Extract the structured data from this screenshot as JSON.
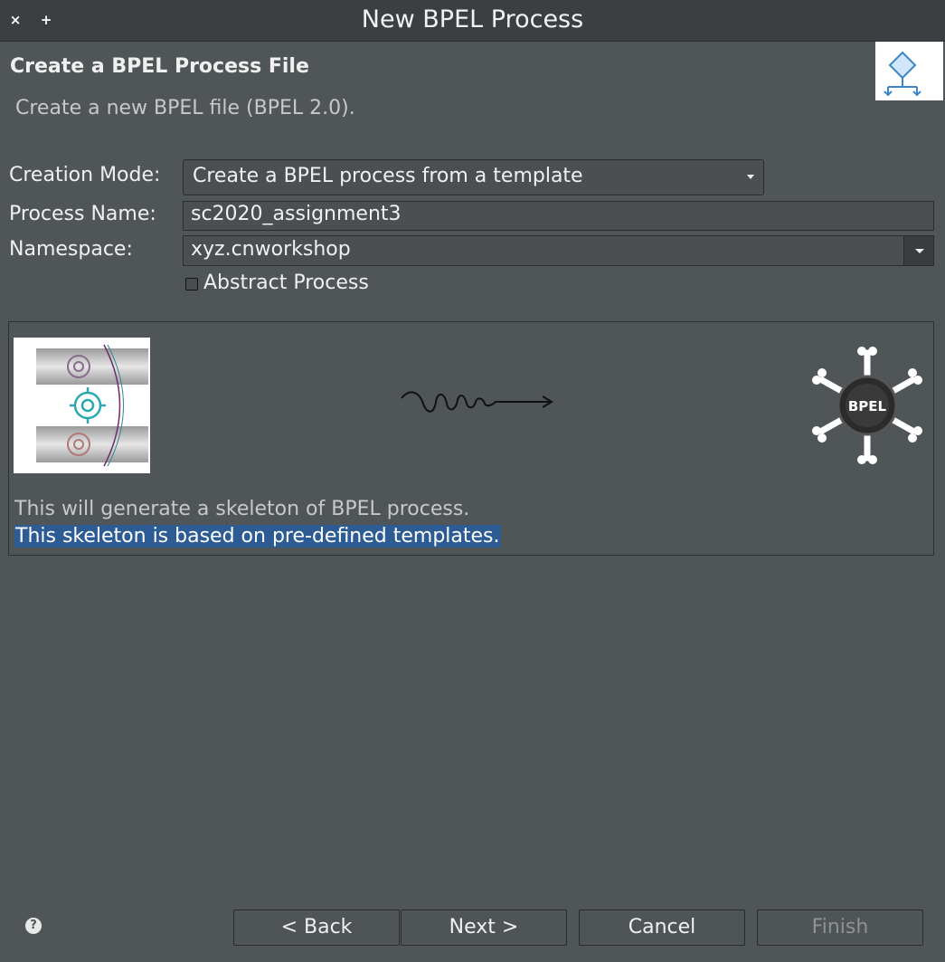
{
  "window": {
    "title": "New BPEL Process",
    "close_glyph": "×",
    "maximize_glyph": "+"
  },
  "header": {
    "title": "Create a BPEL Process File",
    "description": "Create a new BPEL file (BPEL 2.0).",
    "icon": "bpel-wizard-icon"
  },
  "form": {
    "creation_mode_label": "Creation Mode:",
    "creation_mode_value": "Create a BPEL process from a template",
    "process_name_label": "Process Name:",
    "process_name_value": "sc2020_assignment3",
    "namespace_label": "Namespace:",
    "namespace_value": "xyz.cnworkshop",
    "abstract_label": "Abstract Process",
    "abstract_checked": false
  },
  "preview": {
    "line1": "This will generate a skeleton of BPEL process.",
    "line2": "This skeleton is based on pre-defined templates.",
    "bpel_logo_text": "BPEL"
  },
  "footer": {
    "help_glyph": "?",
    "back_label": "< Back",
    "next_label": "Next >",
    "cancel_label": "Cancel",
    "finish_label": "Finish"
  },
  "colors": {
    "background": "#505557",
    "titlebar": "#3c3f41",
    "selection": "#2d5c94"
  }
}
